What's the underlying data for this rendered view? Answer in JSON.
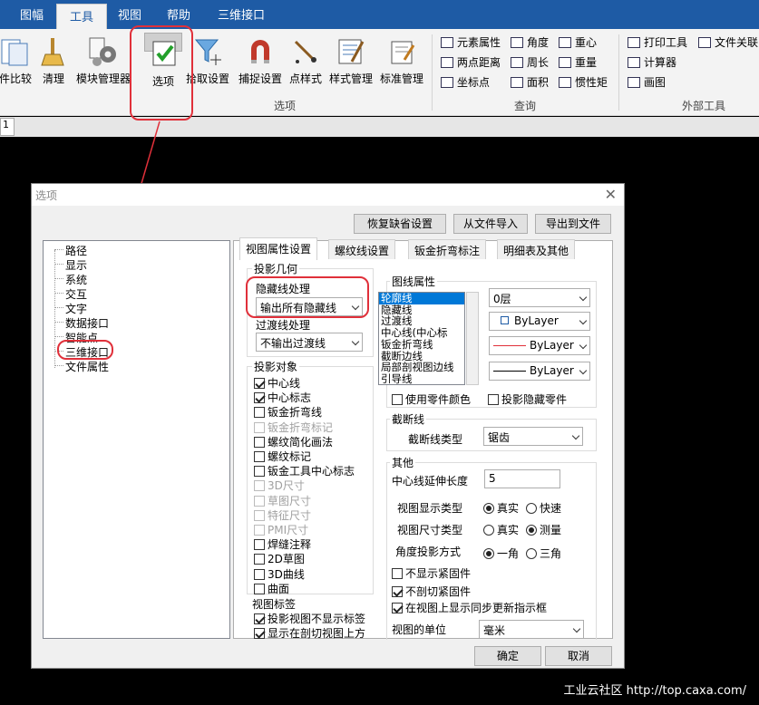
{
  "ribbon": {
    "tabs": [
      "图幅",
      "工具",
      "视图",
      "帮助",
      "三维接口"
    ],
    "buttons": {
      "compare": "件比较",
      "clean": "清理",
      "modules": "模块管理器",
      "options": "选项",
      "pick": "拾取设置",
      "snap": "捕捉设置",
      "point": "点样式",
      "style": "样式管理",
      "standard": "标准管理"
    },
    "groups": {
      "options": "选项",
      "query": "查询",
      "external": "外部工具"
    },
    "query_items": [
      "元素属性",
      "角度",
      "重心",
      "两点距离",
      "周长",
      "重量",
      "坐标点",
      "面积",
      "惯性矩"
    ],
    "external_items": [
      "打印工具",
      "文件关联",
      "计算器",
      "画图"
    ],
    "doc_tab": "1"
  },
  "dialog": {
    "title": "选项",
    "top_buttons": {
      "restore": "恢复缺省设置",
      "import": "从文件导入",
      "export": "导出到文件"
    },
    "tree": [
      "路径",
      "显示",
      "系统",
      "交互",
      "文字",
      "数据接口",
      "智能点",
      "三维接口",
      "文件属性"
    ],
    "tabs": [
      "视图属性设置",
      "螺纹线设置",
      "钣金折弯标注",
      "明细表及其他"
    ],
    "projection": {
      "title": "投影几何",
      "hidden_label": "隐藏线处理",
      "hidden_value": "输出所有隐藏线",
      "transition_label": "过渡线处理",
      "transition_value": "不输出过渡线"
    },
    "objects": {
      "title": "投影对象",
      "items": [
        {
          "label": "中心线",
          "checked": true,
          "disabled": false
        },
        {
          "label": "中心标志",
          "checked": true,
          "disabled": false
        },
        {
          "label": "钣金折弯线",
          "checked": false,
          "disabled": false
        },
        {
          "label": "钣金折弯标记",
          "checked": false,
          "disabled": true
        },
        {
          "label": "螺纹简化画法",
          "checked": false,
          "disabled": false
        },
        {
          "label": "螺纹标记",
          "checked": false,
          "disabled": false
        },
        {
          "label": "钣金工具中心标志",
          "checked": false,
          "disabled": false
        },
        {
          "label": "3D尺寸",
          "checked": false,
          "disabled": true
        },
        {
          "label": "草图尺寸",
          "checked": false,
          "disabled": true
        },
        {
          "label": "特征尺寸",
          "checked": false,
          "disabled": true
        },
        {
          "label": "PMI尺寸",
          "checked": false,
          "disabled": true
        },
        {
          "label": "焊缝注释",
          "checked": false,
          "disabled": false
        },
        {
          "label": "2D草图",
          "checked": false,
          "disabled": false
        },
        {
          "label": "3D曲线",
          "checked": false,
          "disabled": false
        },
        {
          "label": "曲面",
          "checked": false,
          "disabled": false
        }
      ]
    },
    "view_label": {
      "title": "视图标签",
      "items": [
        {
          "label": "投影视图不显示标签",
          "checked": true
        },
        {
          "label": "显示在剖切视图上方",
          "checked": true
        }
      ]
    },
    "line_props": {
      "title": "图线属性",
      "list": [
        "轮廓线",
        "隐藏线",
        "过渡线",
        "中心线(中心标",
        "钣金折弯线",
        "截断边线",
        "局部剖视图边线",
        "引导线"
      ],
      "layer": "0层",
      "color": "ByLayer",
      "linetype": "ByLayer",
      "lineweight": "ByLayer",
      "use_part_color": "使用零件颜色",
      "project_hidden": "投影隐藏零件"
    },
    "section": {
      "title": "截断线",
      "type_label": "截断线类型",
      "type_value": "锯齿"
    },
    "other": {
      "title": "其他",
      "centerline_label": "中心线延伸长度",
      "centerline_value": "5",
      "display_type_label": "视图显示类型",
      "display_type_options": [
        "真实",
        "快速"
      ],
      "dim_type_label": "视图尺寸类型",
      "dim_type_options": [
        "真实",
        "测量"
      ],
      "angle_label": "角度投影方式",
      "angle_options": [
        "一角",
        "三角"
      ],
      "no_fastener": "不显示紧固件",
      "no_cut_fastener": "不剖切紧固件",
      "sync_indicator": "在视图上显示同步更新指示框",
      "units_label": "视图的单位",
      "units_value": "毫米"
    },
    "ok": "确定",
    "cancel": "取消"
  },
  "watermark": "工业云社区 http://top.caxa.com/",
  "colors": {
    "ribbon_blue": "#1e5ba5",
    "annotation_red": "#e0303a"
  }
}
